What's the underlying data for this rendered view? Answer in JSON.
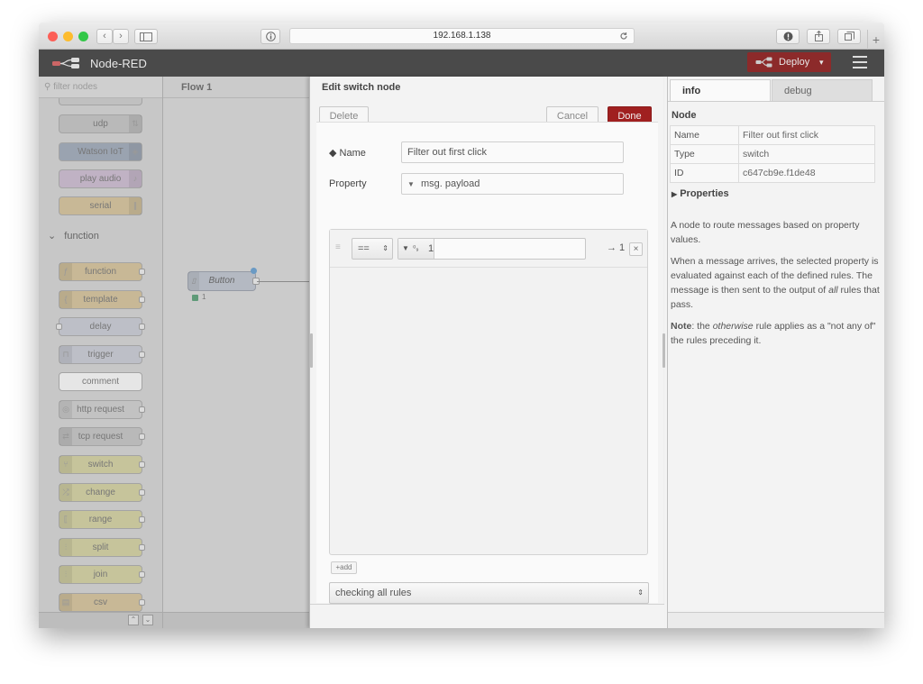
{
  "browser": {
    "url": "192.168.1.138",
    "back": "‹",
    "forward": "›",
    "new_tab": "+"
  },
  "header": {
    "title": "Node-RED",
    "deploy_label": "Deploy",
    "deploy_caret": "▾"
  },
  "palette": {
    "filter_placeholder": "filter nodes",
    "nodes_top": [
      "udp",
      "Watson IoT",
      "play audio",
      "serial"
    ],
    "category": "function",
    "category_chevron": "⌄",
    "nodes": [
      "function",
      "template",
      "delay",
      "trigger",
      "comment",
      "http request",
      "tcp request",
      "switch",
      "change",
      "range",
      "split",
      "join",
      "csv"
    ],
    "footer_up": "⌃",
    "footer_down": "⌄"
  },
  "workspace": {
    "tab": "Flow 1",
    "node_label": "Button",
    "node_count": "1"
  },
  "editor": {
    "title": "Edit switch node",
    "delete_label": "Delete",
    "cancel_label": "Cancel",
    "done_label": "Done",
    "name_label": "Name",
    "name_value": "Filter out first click",
    "property_label": "Property",
    "property_value": "msg. payload",
    "rule": {
      "operator": "==",
      "type_icon": "⁰₉",
      "value": "1",
      "output": "→ 1",
      "remove": "×"
    },
    "add_label": "add",
    "mode_value": "checking all rules"
  },
  "sidebar": {
    "tabs": [
      "info",
      "debug"
    ],
    "node_heading": "Node",
    "rows": [
      {
        "key": "Name",
        "value": "Filter out first click"
      },
      {
        "key": "Type",
        "value": "switch"
      },
      {
        "key": "ID",
        "value": "c647cb9e.f1de48"
      }
    ],
    "properties_label": "Properties",
    "description": {
      "p1": "A node to route messages based on property values.",
      "p2_a": "When a message arrives, the selected property is evaluated against each of the defined rules. The message is then sent to the output of ",
      "p2_em": "all",
      "p2_b": " rules that pass.",
      "p3_bold": "Note",
      "p3_a": ": the ",
      "p3_em": "otherwise",
      "p3_b": " rule applies as a \"not any of\" the rules preceding it."
    }
  }
}
